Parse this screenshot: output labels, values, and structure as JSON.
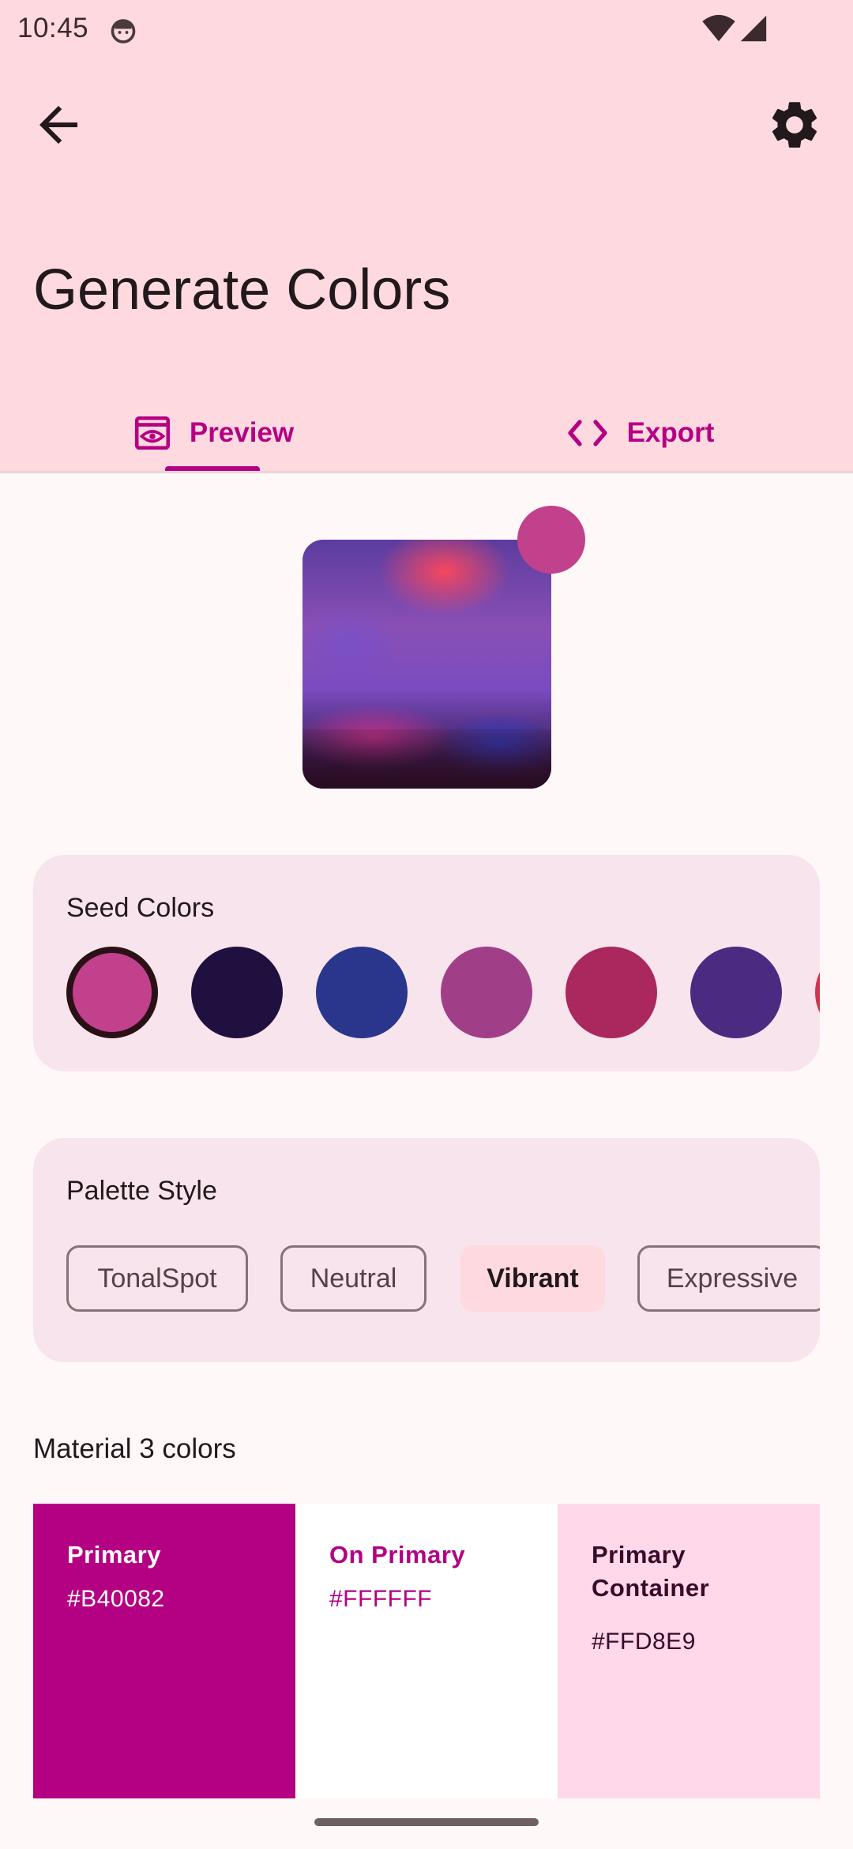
{
  "status_bar": {
    "time": "10:45"
  },
  "header": {
    "title": "Generate Colors",
    "back_icon": "arrow-back-icon",
    "settings_icon": "gear-icon"
  },
  "tabs": [
    {
      "label": "Preview",
      "icon": "eye-icon",
      "selected": true
    },
    {
      "label": "Export",
      "icon": "code-icon",
      "selected": false
    }
  ],
  "preview": {
    "selected_color": "#C1418D"
  },
  "seed_colors": {
    "title": "Seed Colors",
    "colors": [
      "#C1418D",
      "#20103F",
      "#2A368C",
      "#A03F88",
      "#AA285E",
      "#4B2A82",
      "#D0344F"
    ],
    "selected_index": 0
  },
  "palette_style": {
    "title": "Palette Style",
    "options": [
      "TonalSpot",
      "Neutral",
      "Vibrant",
      "Expressive"
    ],
    "selected": "Vibrant"
  },
  "material_colors": {
    "title": "Material 3 colors",
    "tiles": [
      {
        "name": "Primary",
        "hex": "#B40082",
        "bg": "#B40082",
        "fg": "#FFFFFF"
      },
      {
        "name": "On Primary",
        "hex": "#FFFFFF",
        "bg": "#FFFFFF",
        "fg": "#B40082"
      },
      {
        "name": "Primary Container",
        "hex": "#FFD8E9",
        "bg": "#FFD8E9",
        "fg": "#3A0A2A"
      }
    ]
  },
  "theme": {
    "accent": "#B40082",
    "top_bar_bg": "#FFD9E0",
    "card_bg": "#F8E4EC",
    "page_bg": "#FFF8F8"
  }
}
